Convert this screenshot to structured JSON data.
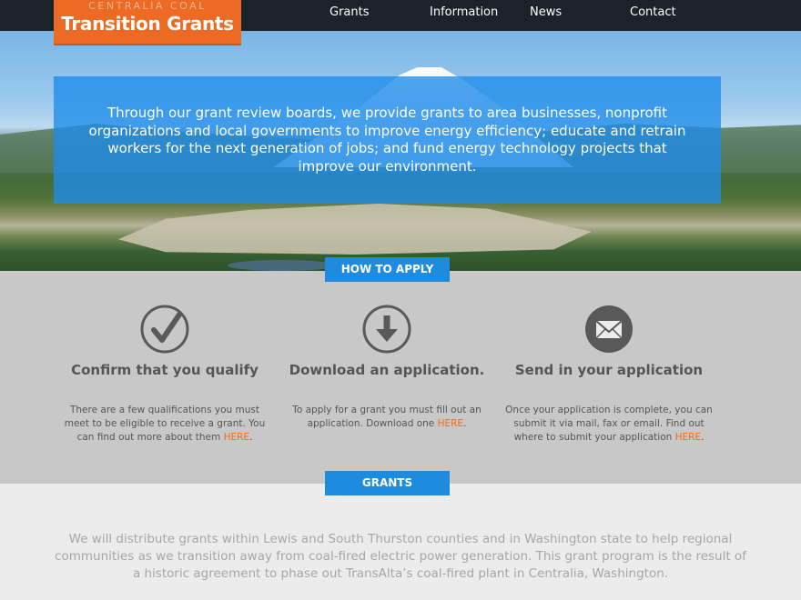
{
  "logo": {
    "subtitle": "CENTRALIA COAL",
    "title": "Transition Grants"
  },
  "nav": {
    "items": [
      "Grants",
      "Information",
      "News",
      "Contact"
    ]
  },
  "hero": {
    "text": "Through our grant review boards, we provide grants to area businesses, nonprofit organizations and local governments to improve energy efficiency; educate and retrain workers for the next generation of jobs; and fund energy technology projects that improve our environment."
  },
  "how_to_apply": {
    "tab_label": "HOW TO APPLY",
    "steps": [
      {
        "icon": "checkmark-icon",
        "title": "Confirm that you qualify",
        "desc": "There are a few qualifications you must meet to be eligible to receive a grant. You can find out more about them ",
        "link": "HERE",
        "end": "."
      },
      {
        "icon": "download-arrow-icon",
        "title": "Download an application.",
        "desc": "To apply for a grant you must fill out an application. Download one ",
        "link": "HERE",
        "end": "."
      },
      {
        "icon": "envelope-icon",
        "title": "Send in your application",
        "desc": "Once your application is complete, you can submit it via mail, fax or email. Find out where to submit your application ",
        "link": "HERE",
        "end": "."
      }
    ]
  },
  "grants": {
    "tab_label": "GRANTS",
    "text": "We will distribute grants within Lewis and South Thurston counties and in Washington state to help regional communities as we transition away from coal-fired electric power generation. This grant program is the result of a historic agreement to phase out TransAlta’s coal-fired plant in Centralia, Washington."
  },
  "colors": {
    "accent_orange": "#ec6a23",
    "accent_blue": "#1e8bdf",
    "nav_bg": "#1c2229"
  }
}
